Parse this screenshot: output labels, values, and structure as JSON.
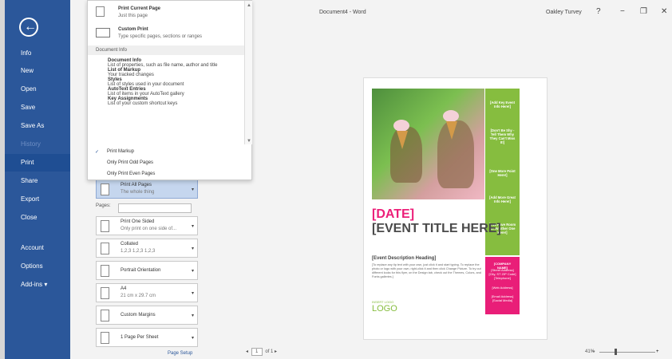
{
  "window": {
    "title": "Document4 - Word",
    "user": "Oakley Turvey",
    "help": "?",
    "minimize": "−",
    "restore": "❐",
    "close": "✕"
  },
  "sidebar": {
    "back": "←",
    "items": [
      {
        "label": "Info"
      },
      {
        "label": "New"
      },
      {
        "label": "Open"
      },
      {
        "label": "Save"
      },
      {
        "label": "Save As"
      },
      {
        "label": "History"
      },
      {
        "label": "Print"
      },
      {
        "label": "Share"
      },
      {
        "label": "Export"
      },
      {
        "label": "Close"
      },
      {
        "label": "Account"
      },
      {
        "label": "Options"
      },
      {
        "label": "Add-ins ▾"
      }
    ]
  },
  "dropdown": {
    "print_current_page": "Print Current Page",
    "just_this_page": "Just this page",
    "custom_print": "Custom Print",
    "custom_print_desc": "Type specific pages, sections or ranges",
    "section": "Document Info",
    "doc_info_lines": [
      {
        "h": "Document Info",
        "d": "List of properties, such as file name, author and title"
      },
      {
        "h": "List of Markup",
        "d": "Your tracked changes"
      },
      {
        "h": "Styles",
        "d": "List of styles used in your document"
      },
      {
        "h": "AutoText Entries",
        "d": "List of items in your AutoText gallery"
      },
      {
        "h": "Key Assignments",
        "d": "List of your custom shortcut keys"
      }
    ],
    "print_markup": "Print Markup",
    "odd": "Only Print Odd Pages",
    "even": "Only Print Even Pages",
    "check": "✓"
  },
  "print_settings": {
    "pages_label": "Pages:",
    "all_pages": "Print All Pages",
    "all_pages_desc": "The whole thing",
    "one_sided": "Print One Sided",
    "one_sided_desc": "Only print on one side of...",
    "collated": "Collated",
    "collated_desc": "1,2,3   1,2,3   1,2,3",
    "orientation": "Portrait Orientation",
    "paper": "A4",
    "paper_desc": "21 cm x 29.7 cm",
    "margins": "Custom Margins",
    "pages_per_sheet": "1 Page Per Sheet",
    "page_setup": "Page Setup",
    "arrow": "▾"
  },
  "preview": {
    "green_items": [
      "[Add Key Event Info Here!]",
      "[Don't Be Shy - Tell Them Why They Can't Miss It!]",
      "[One More Point Here!]",
      "[Add More Great Info Here!]",
      "[You Have Room for Another One Here!]"
    ],
    "company_name": "[COMPANY NAME]",
    "company_address": "[Street Address] [City, ST ZIP Code] [Telephone]",
    "web_address": "[Web Address]",
    "social": "[Email Address] [Social Media]",
    "date": "[DATE]",
    "event_title": "[EVENT TITLE HERE]",
    "description_heading": "[Event Description Heading]",
    "description": "[To replace any tip text with your own, just click it and start typing. To replace the photo or logo with your own, right-click it and then click Change Picture. To try out different looks for this flyer, on the Design tab, check out the Themes, Colors, and Fonts galleries.]",
    "logo_small": "INSERT LOGO",
    "logo": "LOGO"
  },
  "status": {
    "prev": "◂",
    "page": "1",
    "of": "of 1",
    "next": "▸",
    "zoom": "41%",
    "zoom_minus": "−",
    "zoom_plus": "+"
  }
}
